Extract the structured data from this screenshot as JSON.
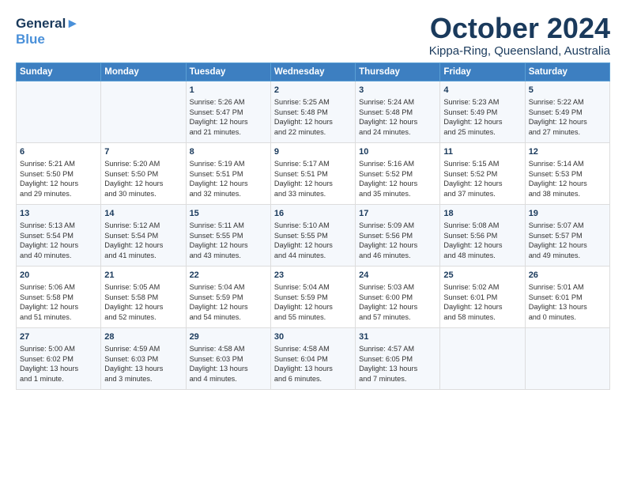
{
  "header": {
    "logo_line1": "General",
    "logo_line2": "Blue",
    "title": "October 2024",
    "subtitle": "Kippa-Ring, Queensland, Australia"
  },
  "columns": [
    "Sunday",
    "Monday",
    "Tuesday",
    "Wednesday",
    "Thursday",
    "Friday",
    "Saturday"
  ],
  "weeks": [
    [
      {
        "day": "",
        "text": ""
      },
      {
        "day": "",
        "text": ""
      },
      {
        "day": "1",
        "text": "Sunrise: 5:26 AM\nSunset: 5:47 PM\nDaylight: 12 hours\nand 21 minutes."
      },
      {
        "day": "2",
        "text": "Sunrise: 5:25 AM\nSunset: 5:48 PM\nDaylight: 12 hours\nand 22 minutes."
      },
      {
        "day": "3",
        "text": "Sunrise: 5:24 AM\nSunset: 5:48 PM\nDaylight: 12 hours\nand 24 minutes."
      },
      {
        "day": "4",
        "text": "Sunrise: 5:23 AM\nSunset: 5:49 PM\nDaylight: 12 hours\nand 25 minutes."
      },
      {
        "day": "5",
        "text": "Sunrise: 5:22 AM\nSunset: 5:49 PM\nDaylight: 12 hours\nand 27 minutes."
      }
    ],
    [
      {
        "day": "6",
        "text": "Sunrise: 5:21 AM\nSunset: 5:50 PM\nDaylight: 12 hours\nand 29 minutes."
      },
      {
        "day": "7",
        "text": "Sunrise: 5:20 AM\nSunset: 5:50 PM\nDaylight: 12 hours\nand 30 minutes."
      },
      {
        "day": "8",
        "text": "Sunrise: 5:19 AM\nSunset: 5:51 PM\nDaylight: 12 hours\nand 32 minutes."
      },
      {
        "day": "9",
        "text": "Sunrise: 5:17 AM\nSunset: 5:51 PM\nDaylight: 12 hours\nand 33 minutes."
      },
      {
        "day": "10",
        "text": "Sunrise: 5:16 AM\nSunset: 5:52 PM\nDaylight: 12 hours\nand 35 minutes."
      },
      {
        "day": "11",
        "text": "Sunrise: 5:15 AM\nSunset: 5:52 PM\nDaylight: 12 hours\nand 37 minutes."
      },
      {
        "day": "12",
        "text": "Sunrise: 5:14 AM\nSunset: 5:53 PM\nDaylight: 12 hours\nand 38 minutes."
      }
    ],
    [
      {
        "day": "13",
        "text": "Sunrise: 5:13 AM\nSunset: 5:54 PM\nDaylight: 12 hours\nand 40 minutes."
      },
      {
        "day": "14",
        "text": "Sunrise: 5:12 AM\nSunset: 5:54 PM\nDaylight: 12 hours\nand 41 minutes."
      },
      {
        "day": "15",
        "text": "Sunrise: 5:11 AM\nSunset: 5:55 PM\nDaylight: 12 hours\nand 43 minutes."
      },
      {
        "day": "16",
        "text": "Sunrise: 5:10 AM\nSunset: 5:55 PM\nDaylight: 12 hours\nand 44 minutes."
      },
      {
        "day": "17",
        "text": "Sunrise: 5:09 AM\nSunset: 5:56 PM\nDaylight: 12 hours\nand 46 minutes."
      },
      {
        "day": "18",
        "text": "Sunrise: 5:08 AM\nSunset: 5:56 PM\nDaylight: 12 hours\nand 48 minutes."
      },
      {
        "day": "19",
        "text": "Sunrise: 5:07 AM\nSunset: 5:57 PM\nDaylight: 12 hours\nand 49 minutes."
      }
    ],
    [
      {
        "day": "20",
        "text": "Sunrise: 5:06 AM\nSunset: 5:58 PM\nDaylight: 12 hours\nand 51 minutes."
      },
      {
        "day": "21",
        "text": "Sunrise: 5:05 AM\nSunset: 5:58 PM\nDaylight: 12 hours\nand 52 minutes."
      },
      {
        "day": "22",
        "text": "Sunrise: 5:04 AM\nSunset: 5:59 PM\nDaylight: 12 hours\nand 54 minutes."
      },
      {
        "day": "23",
        "text": "Sunrise: 5:04 AM\nSunset: 5:59 PM\nDaylight: 12 hours\nand 55 minutes."
      },
      {
        "day": "24",
        "text": "Sunrise: 5:03 AM\nSunset: 6:00 PM\nDaylight: 12 hours\nand 57 minutes."
      },
      {
        "day": "25",
        "text": "Sunrise: 5:02 AM\nSunset: 6:01 PM\nDaylight: 12 hours\nand 58 minutes."
      },
      {
        "day": "26",
        "text": "Sunrise: 5:01 AM\nSunset: 6:01 PM\nDaylight: 13 hours\nand 0 minutes."
      }
    ],
    [
      {
        "day": "27",
        "text": "Sunrise: 5:00 AM\nSunset: 6:02 PM\nDaylight: 13 hours\nand 1 minute."
      },
      {
        "day": "28",
        "text": "Sunrise: 4:59 AM\nSunset: 6:03 PM\nDaylight: 13 hours\nand 3 minutes."
      },
      {
        "day": "29",
        "text": "Sunrise: 4:58 AM\nSunset: 6:03 PM\nDaylight: 13 hours\nand 4 minutes."
      },
      {
        "day": "30",
        "text": "Sunrise: 4:58 AM\nSunset: 6:04 PM\nDaylight: 13 hours\nand 6 minutes."
      },
      {
        "day": "31",
        "text": "Sunrise: 4:57 AM\nSunset: 6:05 PM\nDaylight: 13 hours\nand 7 minutes."
      },
      {
        "day": "",
        "text": ""
      },
      {
        "day": "",
        "text": ""
      }
    ]
  ]
}
